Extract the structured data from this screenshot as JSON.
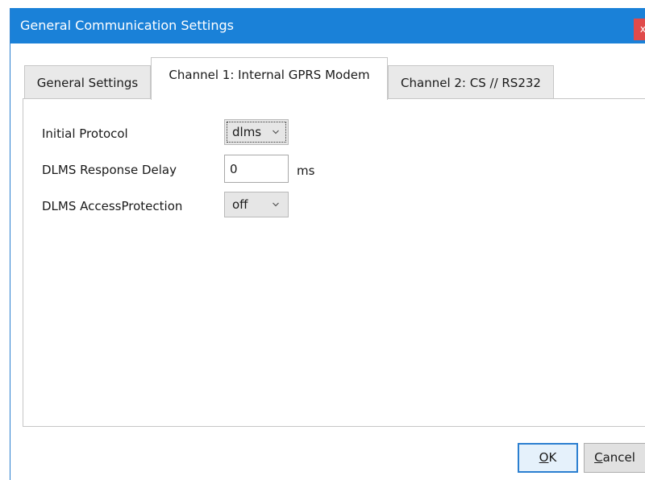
{
  "window": {
    "title": "General Communication Settings",
    "close_glyph": "x",
    "titlebar_color": "#1a81d8",
    "close_color": "#e04b4b"
  },
  "tabs": [
    {
      "label": "General Settings",
      "selected": false
    },
    {
      "label": "Channel 1: Internal GPRS Modem",
      "selected": true
    },
    {
      "label": "Channel 2: CS // RS232",
      "selected": false
    }
  ],
  "form": {
    "initial_protocol": {
      "label": "Initial Protocol",
      "value": "dlms",
      "icon": "chevron-down-icon"
    },
    "response_delay": {
      "label": "DLMS Response Delay",
      "value": "0",
      "unit": "ms"
    },
    "access_protection": {
      "label": "DLMS AccessProtection",
      "value": "off",
      "icon": "chevron-down-icon"
    }
  },
  "buttons": {
    "ok": {
      "accel": "O",
      "rest": "K"
    },
    "cancel": {
      "accel": "C",
      "rest": "ancel"
    }
  }
}
